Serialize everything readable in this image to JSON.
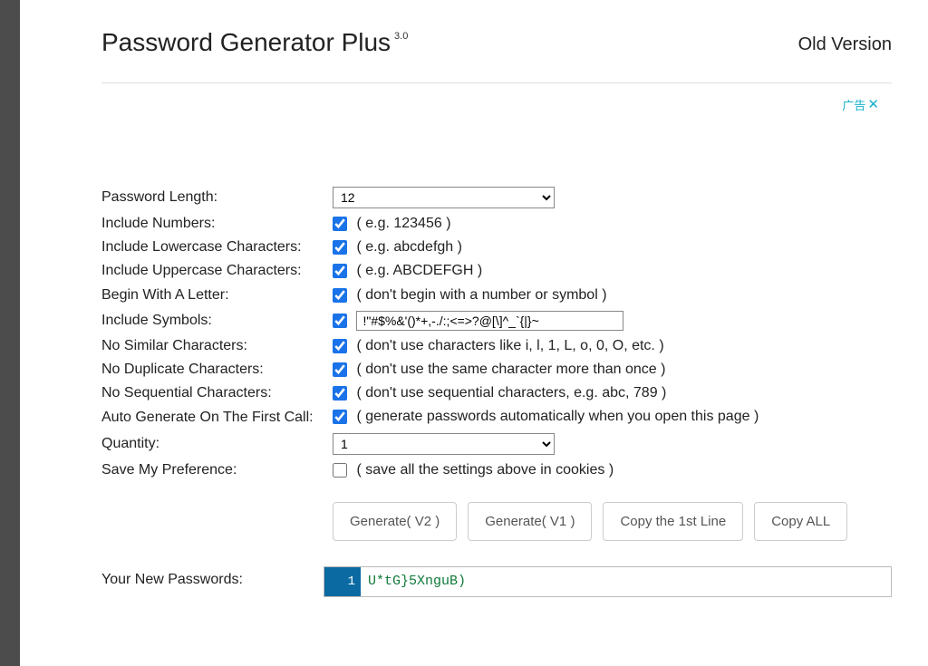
{
  "header": {
    "title": "Password Generator Plus",
    "version": "3.0",
    "old_link": "Old Version"
  },
  "ad": {
    "label": "广告",
    "close": "✕"
  },
  "labels": {
    "length": "Password Length:",
    "numbers": "Include Numbers:",
    "lower": "Include Lowercase Characters:",
    "upper": "Include Uppercase Characters:",
    "begin": "Begin With A Letter:",
    "symbols": "Include Symbols:",
    "similar": "No Similar Characters:",
    "dup": "No Duplicate Characters:",
    "seq": "No Sequential Characters:",
    "auto": "Auto Generate On The First Call:",
    "qty": "Quantity:",
    "save": "Save My Preference:",
    "output": "Your New Passwords:"
  },
  "hints": {
    "numbers": "( e.g. 123456 )",
    "lower": "( e.g. abcdefgh )",
    "upper": "( e.g. ABCDEFGH )",
    "begin": "( don't begin with a number or symbol )",
    "similar": "( don't use characters like i, l, 1, L, o, 0, O, etc. )",
    "dup": "( don't use the same character more than once )",
    "seq": "( don't use sequential characters, e.g. abc, 789 )",
    "auto": "( generate passwords automatically when you open this page )",
    "save": "( save all the settings above in cookies )"
  },
  "values": {
    "length": "12",
    "symbols_text": "!\"#$%&'()*+,-./:;<=>?@[\\]^_`{|}~",
    "qty": "1"
  },
  "buttons": {
    "gen2": "Generate( V2 )",
    "gen1": "Generate( V1 )",
    "copy1": "Copy the 1st Line",
    "copyall": "Copy ALL"
  },
  "output": {
    "line_no": "1",
    "password": "U*tG}5XnguB)"
  }
}
